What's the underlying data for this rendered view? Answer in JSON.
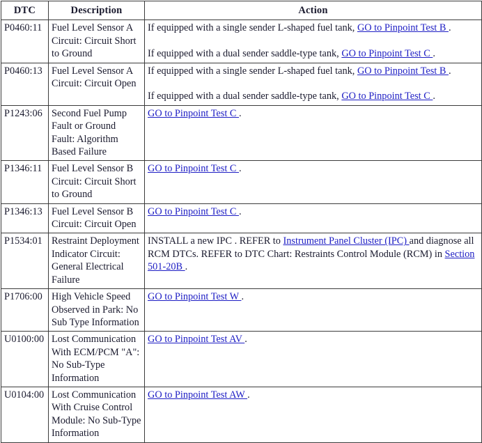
{
  "table": {
    "columns": [
      {
        "key": "dtc",
        "label": "DTC"
      },
      {
        "key": "description",
        "label": "Description"
      },
      {
        "key": "action",
        "label": "Action"
      }
    ],
    "link_color": "#1d1dc4",
    "text_color": "#1a1a2e",
    "border_color": "#3b3b3b",
    "rows": [
      {
        "dtc": "P0460:11",
        "description": "Fuel Level Sensor A Circuit: Circuit Short to Ground",
        "action_paragraphs": [
          {
            "segments": [
              {
                "type": "text",
                "text": "If equipped with a single sender L-shaped fuel tank, "
              },
              {
                "type": "link",
                "text": "GO to Pinpoint Test B "
              },
              {
                "type": "text",
                "text": "."
              }
            ]
          },
          {
            "segments": [
              {
                "type": "text",
                "text": "If equipped with a dual sender saddle-type tank, "
              },
              {
                "type": "link",
                "text": "GO to Pinpoint Test C "
              },
              {
                "type": "text",
                "text": "."
              }
            ]
          }
        ]
      },
      {
        "dtc": "P0460:13",
        "description": "Fuel Level Sensor A Circuit: Circuit Open",
        "action_paragraphs": [
          {
            "segments": [
              {
                "type": "text",
                "text": "If equipped with a single sender L-shaped fuel tank, "
              },
              {
                "type": "link",
                "text": "GO to Pinpoint Test B "
              },
              {
                "type": "text",
                "text": "."
              }
            ]
          },
          {
            "segments": [
              {
                "type": "text",
                "text": "If equipped with a dual sender saddle-type tank, "
              },
              {
                "type": "link",
                "text": "GO to Pinpoint Test C "
              },
              {
                "type": "text",
                "text": "."
              }
            ]
          }
        ]
      },
      {
        "dtc": "P1243:06",
        "description": "Second Fuel Pump Fault or Ground Fault: Algorithm Based Failure",
        "action_paragraphs": [
          {
            "segments": [
              {
                "type": "link",
                "text": "GO to Pinpoint Test C "
              },
              {
                "type": "text",
                "text": "."
              }
            ]
          }
        ]
      },
      {
        "dtc": "P1346:11",
        "description": "Fuel Level Sensor B Circuit: Circuit Short to Ground",
        "action_paragraphs": [
          {
            "segments": [
              {
                "type": "link",
                "text": "GO to Pinpoint Test C "
              },
              {
                "type": "text",
                "text": "."
              }
            ]
          }
        ]
      },
      {
        "dtc": "P1346:13",
        "description": "Fuel Level Sensor B Circuit: Circuit Open",
        "action_paragraphs": [
          {
            "segments": [
              {
                "type": "link",
                "text": "GO to Pinpoint Test C "
              },
              {
                "type": "text",
                "text": "."
              }
            ]
          }
        ]
      },
      {
        "dtc": "P1534:01",
        "description": "Restraint Deployment Indicator Circuit: General Electrical Failure",
        "action_paragraphs": [
          {
            "segments": [
              {
                "type": "text",
                "text": "INSTALL a new IPC . REFER to "
              },
              {
                "type": "link",
                "text": "Instrument Panel Cluster (IPC) "
              },
              {
                "type": "text",
                "text": "and diagnose all RCM DTCs. REFER to DTC Chart: Restraints Control Module (RCM) in "
              },
              {
                "type": "link",
                "text": "Section 501-20B "
              },
              {
                "type": "text",
                "text": "."
              }
            ]
          }
        ]
      },
      {
        "dtc": "P1706:00",
        "description": "High Vehicle Speed Observed in Park: No Sub Type Information",
        "action_paragraphs": [
          {
            "segments": [
              {
                "type": "link",
                "text": "GO to Pinpoint Test W "
              },
              {
                "type": "text",
                "text": "."
              }
            ]
          }
        ]
      },
      {
        "dtc": "U0100:00",
        "description": "Lost Communication With ECM/PCM \"A\": No Sub-Type Information",
        "action_paragraphs": [
          {
            "segments": [
              {
                "type": "link",
                "text": "GO to Pinpoint Test AV "
              },
              {
                "type": "text",
                "text": "."
              }
            ]
          }
        ]
      },
      {
        "dtc": "U0104:00",
        "description": "Lost Communication With Cruise Control Module: No Sub-Type Information",
        "action_paragraphs": [
          {
            "segments": [
              {
                "type": "link",
                "text": "GO to Pinpoint Test AW "
              },
              {
                "type": "text",
                "text": "."
              }
            ]
          }
        ]
      }
    ]
  }
}
